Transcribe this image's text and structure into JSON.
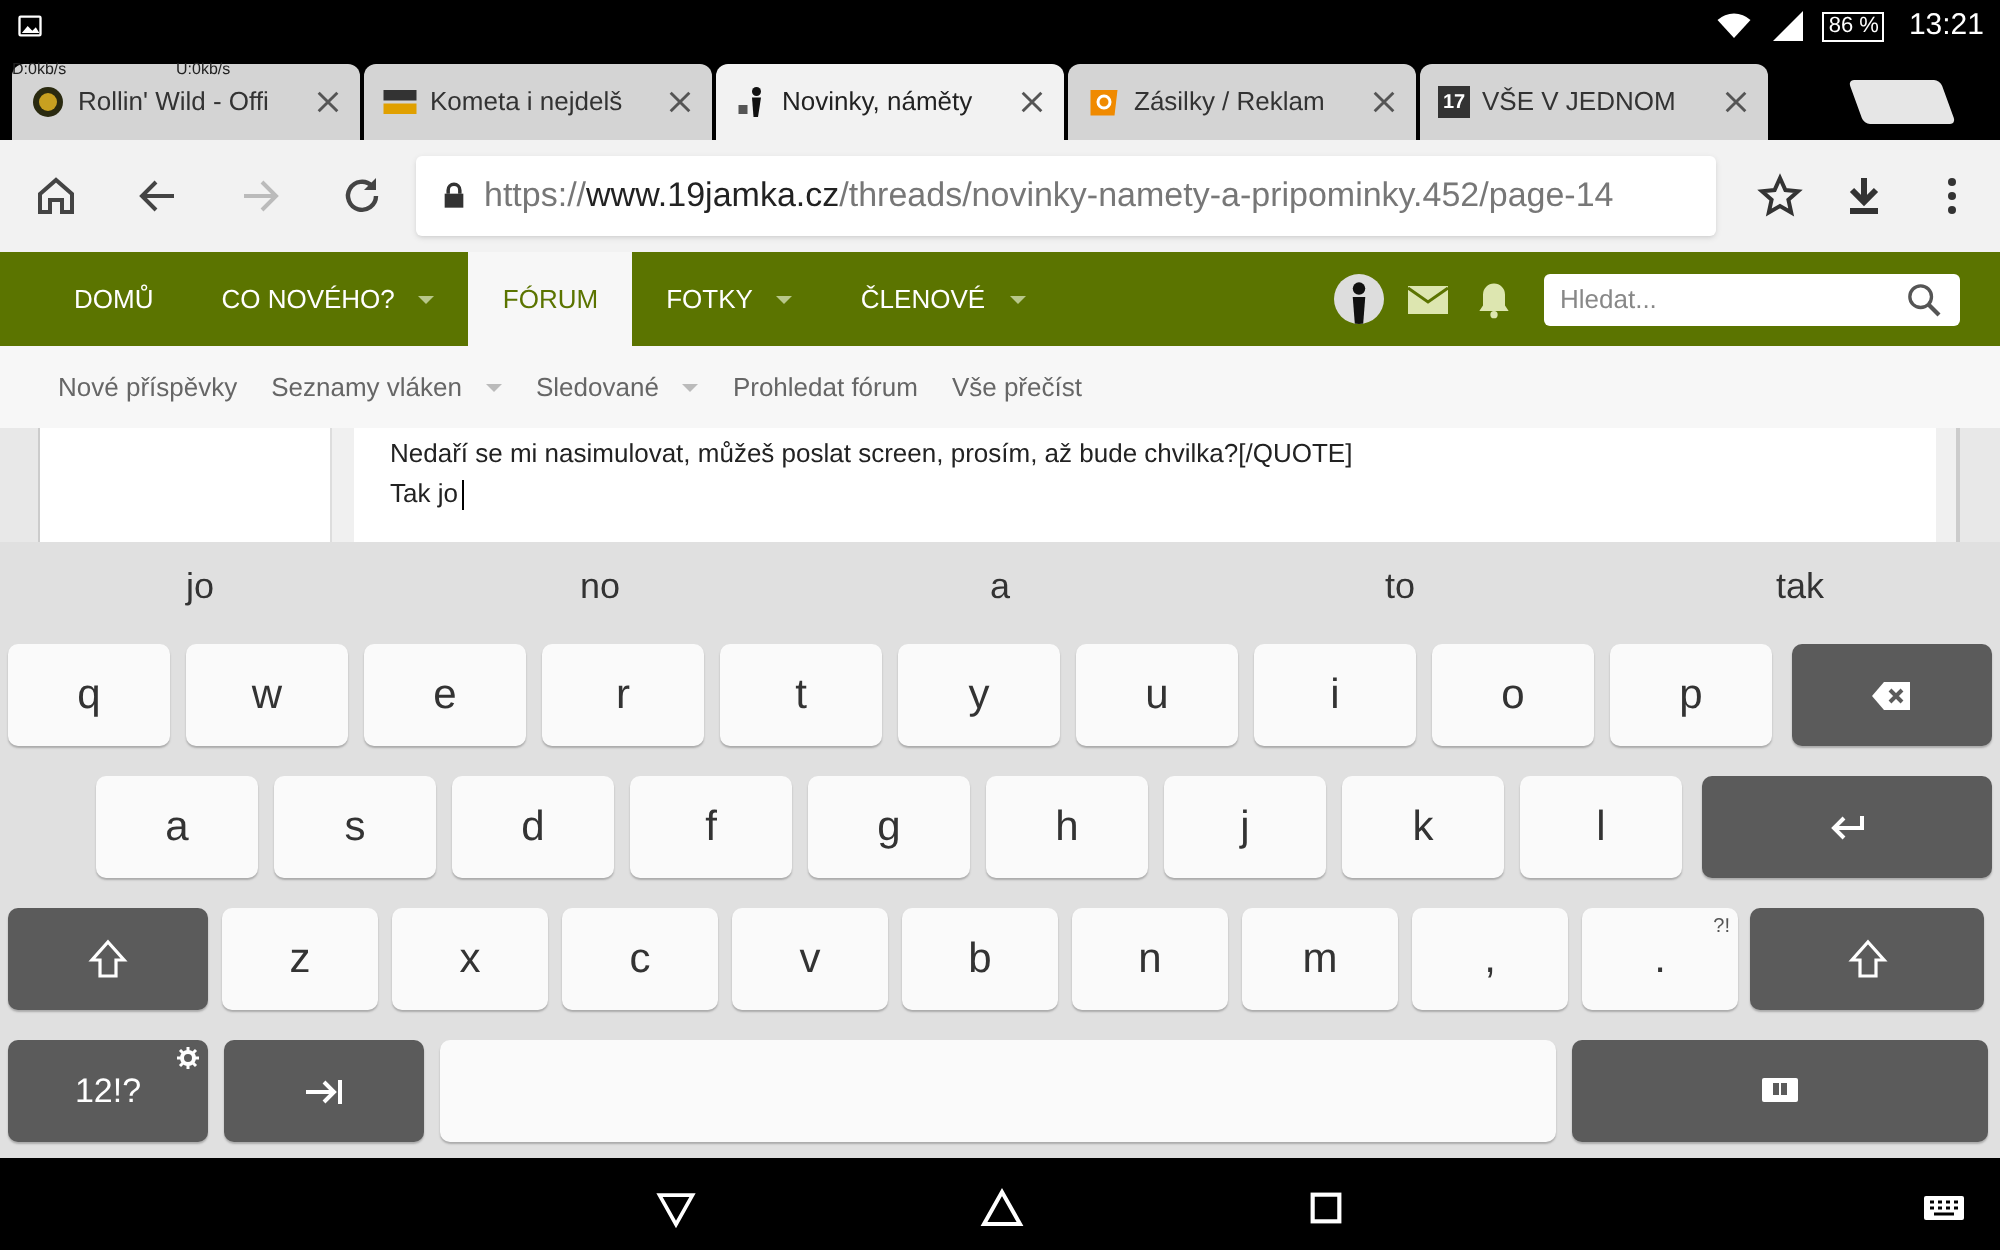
{
  "status_bar": {
    "time": "13:21",
    "battery": "86 %",
    "download": "D:0kb/s",
    "upload": "U:0kb/s"
  },
  "tabs": [
    {
      "title": "Rollin' Wild - Offi",
      "selected": false,
      "kind": "dark"
    },
    {
      "title": "Kometa i nejdelš",
      "selected": false,
      "kind": "stripes"
    },
    {
      "title": "Novinky, náměty",
      "selected": true,
      "kind": "figure"
    },
    {
      "title": "Zásilky / Reklam",
      "selected": false,
      "kind": "orange"
    },
    {
      "title": "VŠE V JEDNOM",
      "selected": false,
      "kind": "number"
    }
  ],
  "tab_favicon_text": [
    "17"
  ],
  "address_bar": {
    "scheme": "https://",
    "host": "www.19jamka.cz",
    "path": "/threads/novinky-namety-a-pripominky.452/page-14"
  },
  "nav": [
    {
      "label": "DOMŮ",
      "selected": false,
      "dropdown": false
    },
    {
      "label": "CO NOVÉHO?",
      "selected": false,
      "dropdown": true
    },
    {
      "label": "FÓRUM",
      "selected": true,
      "dropdown": false
    },
    {
      "label": "FOTKY",
      "selected": false,
      "dropdown": true
    },
    {
      "label": "ČLENOVÉ",
      "selected": false,
      "dropdown": true
    }
  ],
  "search": {
    "placeholder": "Hledat..."
  },
  "subnav": [
    {
      "label": "Nové příspěvky",
      "dropdown": false
    },
    {
      "label": "Seznamy vláken",
      "dropdown": true
    },
    {
      "label": "Sledované",
      "dropdown": true
    },
    {
      "label": "Prohledat fórum",
      "dropdown": false
    },
    {
      "label": "Vše přečíst",
      "dropdown": false
    }
  ],
  "editor": {
    "lines": [
      "Nedaří se mi nasimulovat, můžeš poslat screen, prosím, až bude chvilka?[/QUOTE]",
      "Tak jo"
    ]
  },
  "suggestions": [
    "jo",
    "no",
    "a",
    "to",
    "tak"
  ],
  "keyboard": [
    [
      {
        "kind": "letter",
        "label": "q"
      },
      {
        "kind": "letter",
        "label": "w"
      },
      {
        "kind": "letter",
        "label": "e"
      },
      {
        "kind": "letter",
        "label": "r"
      },
      {
        "kind": "letter",
        "label": "t"
      },
      {
        "kind": "letter",
        "label": "y"
      },
      {
        "kind": "letter",
        "label": "u"
      },
      {
        "kind": "letter",
        "label": "i"
      },
      {
        "kind": "letter",
        "label": "o"
      },
      {
        "kind": "letter",
        "label": "p"
      },
      {
        "kind": "backspace"
      }
    ],
    [
      {
        "kind": "letter",
        "label": "a"
      },
      {
        "kind": "letter",
        "label": "s"
      },
      {
        "kind": "letter",
        "label": "d"
      },
      {
        "kind": "letter",
        "label": "f"
      },
      {
        "kind": "letter",
        "label": "g"
      },
      {
        "kind": "letter",
        "label": "h"
      },
      {
        "kind": "letter",
        "label": "j"
      },
      {
        "kind": "letter",
        "label": "k"
      },
      {
        "kind": "letter",
        "label": "l"
      },
      {
        "kind": "enter"
      }
    ],
    [
      {
        "kind": "shift"
      },
      {
        "kind": "letter",
        "label": "z"
      },
      {
        "kind": "letter",
        "label": "x"
      },
      {
        "kind": "letter",
        "label": "c"
      },
      {
        "kind": "letter",
        "label": "v"
      },
      {
        "kind": "letter",
        "label": "b"
      },
      {
        "kind": "letter",
        "label": "n"
      },
      {
        "kind": "letter",
        "label": "m"
      },
      {
        "kind": "letter",
        "label": ","
      },
      {
        "kind": "letter",
        "label": ".",
        "hint": "?!"
      },
      {
        "kind": "shift"
      }
    ],
    [
      {
        "kind": "symbols",
        "label": "12!?"
      },
      {
        "kind": "tab"
      },
      {
        "kind": "space"
      },
      {
        "kind": "hide"
      }
    ]
  ]
}
